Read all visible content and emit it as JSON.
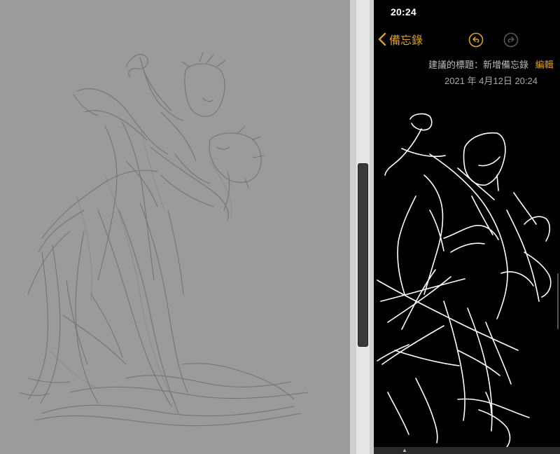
{
  "status_bar": {
    "time": "20:24"
  },
  "notes": {
    "back_label": "備忘錄",
    "undo_icon": "undo-icon",
    "redo_icon": "redo-icon",
    "title_hint": "建議的標題：新增備忘錄",
    "edit_label": "編輯",
    "date": "2021 年 4月12日 20:24"
  },
  "colors": {
    "accent": "#d9a32a",
    "left_canvas": "#9b9b9b",
    "notes_background": "#000000",
    "pencil_stroke": "#6a6a6a",
    "ink_stroke": "#ffffff"
  }
}
